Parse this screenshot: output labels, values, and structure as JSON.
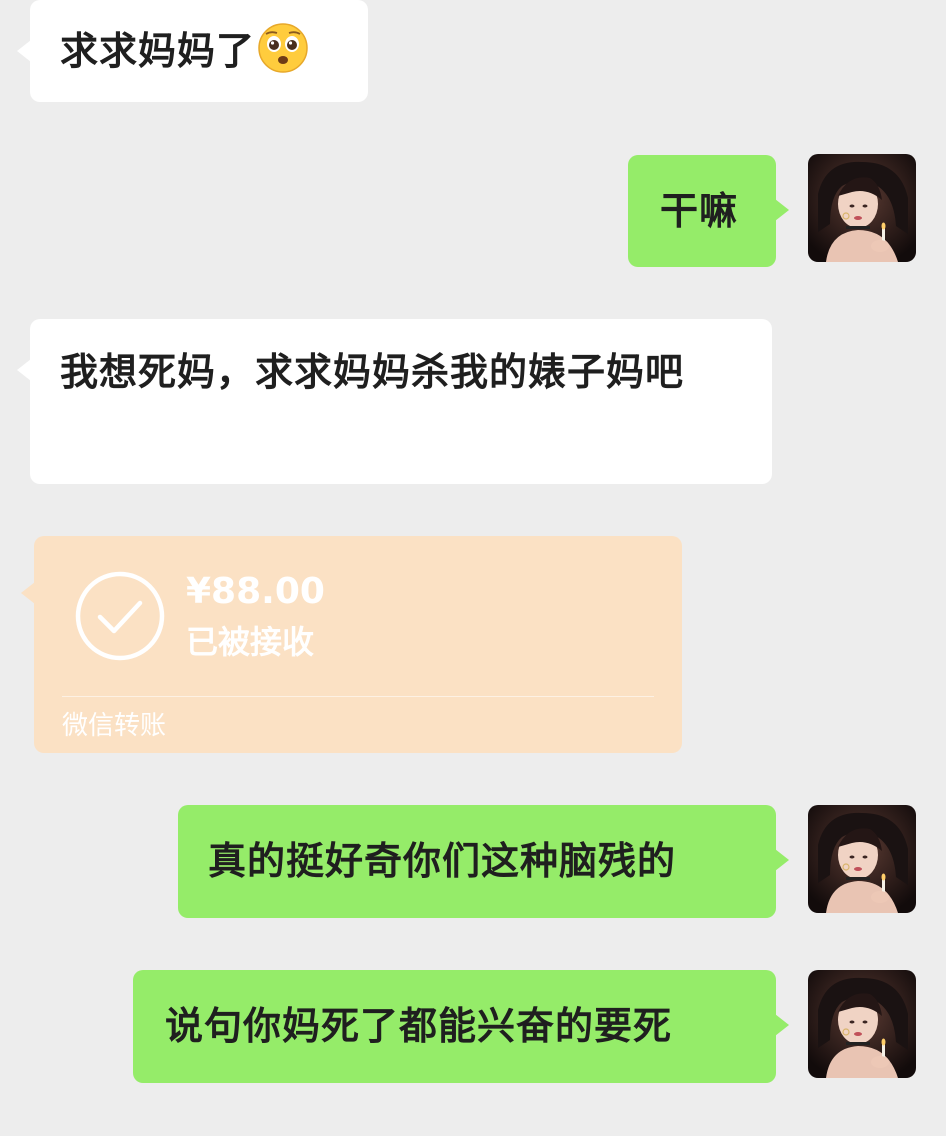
{
  "messages": [
    {
      "side": "left",
      "text": "求求妈妈了",
      "emoji": "pleading-face-emoji"
    },
    {
      "side": "right",
      "text": "干嘛"
    },
    {
      "side": "left",
      "text": "我想死妈，求求妈妈杀我的婊子妈吧"
    },
    {
      "side": "right",
      "text": "真的挺好奇你们这种脑残的"
    },
    {
      "side": "right",
      "text": "说句你妈死了都能兴奋的要死"
    }
  ],
  "transfer": {
    "amount": "¥88.00",
    "status": "已被接收",
    "footer": "微信转账",
    "icon": "check-circle-icon"
  },
  "colors": {
    "background": "#ededed",
    "incoming_bubble": "#ffffff",
    "outgoing_bubble": "#95ec69",
    "transfer_card": "#fbe1c4"
  }
}
